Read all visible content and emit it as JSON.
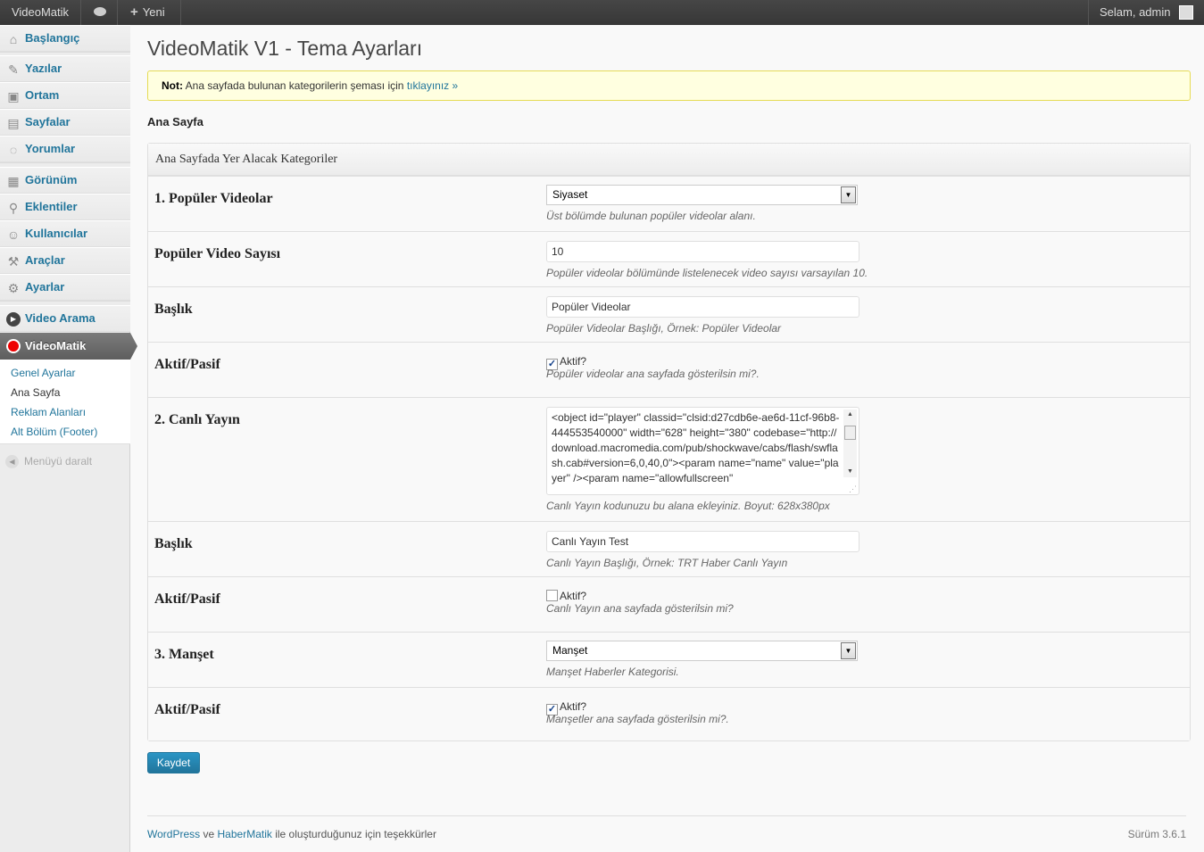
{
  "adminbar": {
    "site_name": "VideoMatik",
    "new_label": "Yeni",
    "greeting": "Selam, admin"
  },
  "menu": {
    "items": [
      {
        "label": "Başlangıç",
        "icon": "home-icon"
      },
      {
        "label": "Yazılar",
        "icon": "pin-icon"
      },
      {
        "label": "Ortam",
        "icon": "media-icon"
      },
      {
        "label": "Sayfalar",
        "icon": "pages-icon"
      },
      {
        "label": "Yorumlar",
        "icon": "comments-icon"
      },
      {
        "label": "Görünüm",
        "icon": "appearance-icon"
      },
      {
        "label": "Eklentiler",
        "icon": "plugins-icon"
      },
      {
        "label": "Kullanıcılar",
        "icon": "users-icon"
      },
      {
        "label": "Araçlar",
        "icon": "tools-icon"
      },
      {
        "label": "Ayarlar",
        "icon": "settings-icon"
      },
      {
        "label": "Video Arama",
        "icon": "play-icon"
      },
      {
        "label": "VideoMatik",
        "icon": "record-icon"
      }
    ],
    "submenu": [
      "Genel Ayarlar",
      "Ana Sayfa",
      "Reklam Alanları",
      "Alt Bölüm (Footer)"
    ],
    "collapse_label": "Menüyü daralt"
  },
  "page": {
    "title": "VideoMatik V1 - Tema Ayarları",
    "notice_bold": "Not:",
    "notice_text": "Ana sayfada bulunan kategorilerin şeması için",
    "notice_link": "tıklayınız »",
    "section_title": "Ana Sayfa",
    "box_title": "Ana Sayfada Yer Alacak Kategoriler"
  },
  "fields": {
    "populer_videolar": {
      "label": "1. Popüler Videolar",
      "value": "Siyaset",
      "desc": "Üst bölümde bulunan popüler videolar alanı."
    },
    "populer_sayi": {
      "label": "Popüler Video Sayısı",
      "value": "10",
      "desc": "Popüler videolar bölümünde listelenecek video sayısı varsayılan 10."
    },
    "populer_baslik": {
      "label": "Başlık",
      "value": "Popüler Videolar",
      "desc": "Popüler Videolar Başlığı, Örnek: Popüler Videolar"
    },
    "populer_aktif": {
      "label": "Aktif/Pasif",
      "cb_label": "Aktif?",
      "checked": true,
      "desc": "Popüler videolar ana sayfada gösterilsin mi?."
    },
    "canli_yayin": {
      "label": "2. Canlı Yayın",
      "value": "<object id=\"player\" classid=\"clsid:d27cdb6e-ae6d-11cf-96b8-444553540000\" width=\"628\" height=\"380\" codebase=\"http://download.macromedia.com/pub/shockwave/cabs/flash/swflash.cab#version=6,0,40,0\"><param name=\"name\" value=\"player\" /><param name=\"allowfullscreen\"",
      "desc": "Canlı Yayın kodunuzu bu alana ekleyiniz. Boyut: 628x380px"
    },
    "canli_baslik": {
      "label": "Başlık",
      "value": "Canlı Yayın Test",
      "desc": "Canlı Yayın Başlığı, Örnek: TRT Haber Canlı Yayın"
    },
    "canli_aktif": {
      "label": "Aktif/Pasif",
      "cb_label": "Aktif?",
      "checked": false,
      "desc": "Canlı Yayın ana sayfada gösterilsin mi?"
    },
    "manset": {
      "label": "3. Manşet",
      "value": "Manşet",
      "desc": "Manşet Haberler Kategorisi."
    },
    "manset_aktif": {
      "label": "Aktif/Pasif",
      "cb_label": "Aktif?",
      "checked": true,
      "desc": "Manşetler ana sayfada gösterilsin mi?."
    }
  },
  "save_label": "Kaydet",
  "footer": {
    "wp_link": "WordPress",
    "and": "ve",
    "hm_link": "HaberMatik",
    "text": "ile oluşturduğunuz için teşekkürler",
    "version": "Sürüm 3.6.1"
  }
}
